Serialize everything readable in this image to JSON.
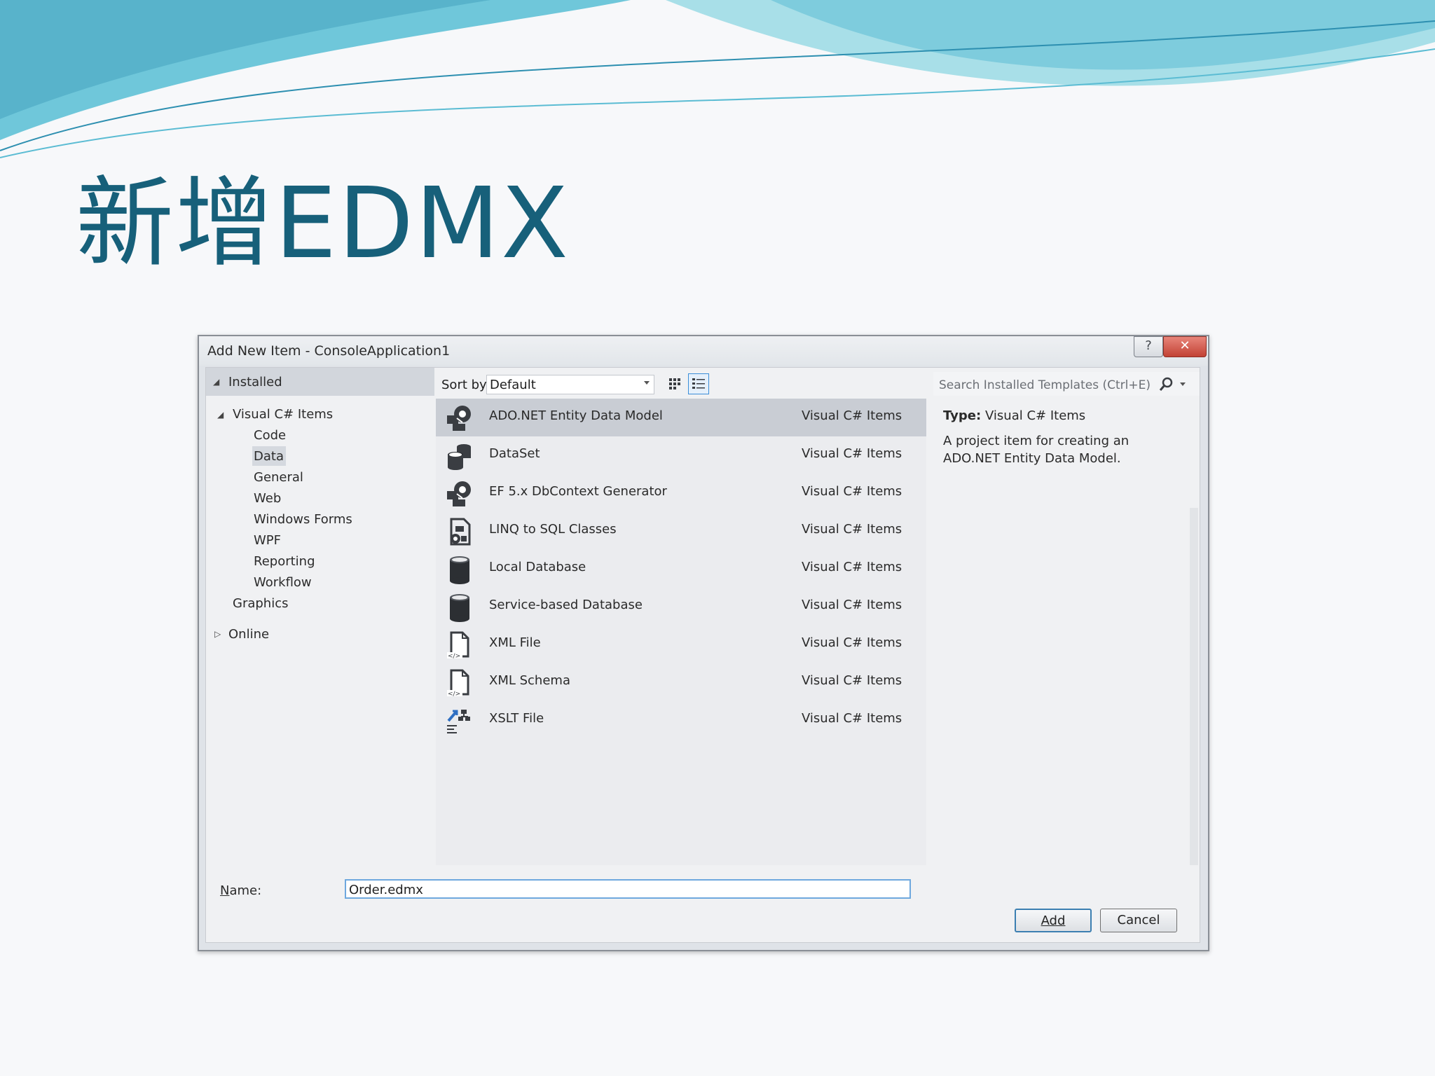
{
  "slide": {
    "title": "新增EDMX",
    "colors": {
      "title": "#17607a",
      "wave_light": "#a8dfe8",
      "wave_mid": "#5bbcd3",
      "wave_dark": "#2d8fb0"
    }
  },
  "dialog": {
    "title": "Add New Item - ConsoleApplication1",
    "help_glyph": "?",
    "close_glyph": "✕",
    "tree": {
      "installed": "Installed",
      "visual_csharp_items": "Visual C# Items",
      "children": [
        "Code",
        "Data",
        "General",
        "Web",
        "Windows Forms",
        "WPF",
        "Reporting",
        "Workflow"
      ],
      "selected": "Data",
      "graphics": "Graphics",
      "online": "Online"
    },
    "sort": {
      "label": "Sort by:",
      "value": "Default"
    },
    "search": {
      "placeholder": "Search Installed Templates (Ctrl+E)"
    },
    "items": [
      {
        "name": "ADO.NET Entity Data Model",
        "category": "Visual C# Items",
        "icon": "entity-model-icon",
        "selected": true
      },
      {
        "name": "DataSet",
        "category": "Visual C# Items",
        "icon": "dataset-icon"
      },
      {
        "name": "EF 5.x DbContext Generator",
        "category": "Visual C# Items",
        "icon": "dbcontext-generator-icon"
      },
      {
        "name": "LINQ to SQL Classes",
        "category": "Visual C# Items",
        "icon": "linq-to-sql-icon"
      },
      {
        "name": "Local Database",
        "category": "Visual C# Items",
        "icon": "database-icon"
      },
      {
        "name": "Service-based Database",
        "category": "Visual C# Items",
        "icon": "database-icon"
      },
      {
        "name": "XML File",
        "category": "Visual C# Items",
        "icon": "xml-file-icon"
      },
      {
        "name": "XML Schema",
        "category": "Visual C# Items",
        "icon": "xml-schema-icon"
      },
      {
        "name": "XSLT File",
        "category": "Visual C# Items",
        "icon": "xslt-file-icon"
      }
    ],
    "details": {
      "type_label": "Type:",
      "type_value": "Visual C# Items",
      "description": "A project item for creating an ADO.NET Entity Data Model."
    },
    "name": {
      "label": "Name:",
      "value": "Order.edmx"
    },
    "buttons": {
      "add": "Add",
      "cancel": "Cancel"
    }
  }
}
